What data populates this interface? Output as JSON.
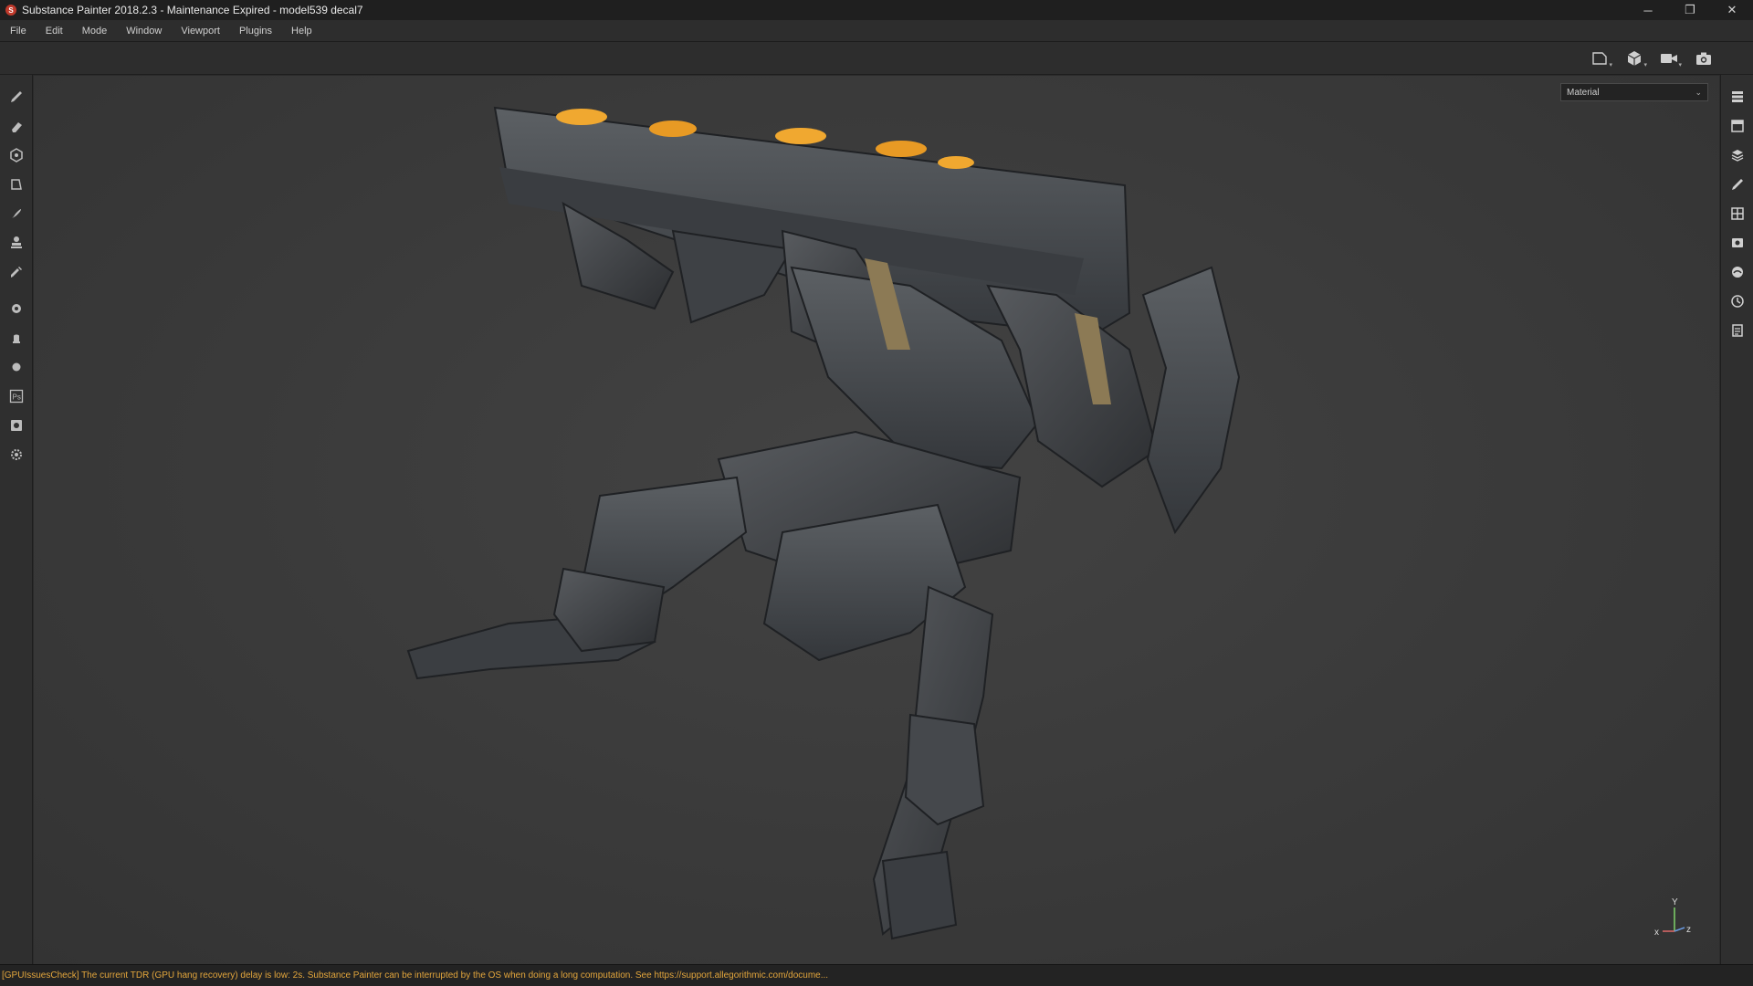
{
  "window": {
    "title": "Substance Painter 2018.2.3 - Maintenance Expired - model539 decal7",
    "controls": {
      "minimize": "─",
      "restore": "❐",
      "close": "✕"
    }
  },
  "menu": {
    "items": [
      "File",
      "Edit",
      "Mode",
      "Window",
      "Viewport",
      "Plugins",
      "Help"
    ]
  },
  "viewport_toolbar": {
    "icons": [
      "2d-view-icon",
      "3d-view-icon",
      "camera-icon",
      "screenshot-icon"
    ]
  },
  "left_tools": [
    "paint-brush-icon",
    "eraser-icon",
    "projection-icon",
    "polygon-fill-icon",
    "smudge-icon",
    "clone-icon",
    "color-picker-icon",
    "bake-icon",
    "iray-icon",
    "plugin-icon",
    "photoshop-icon",
    "export-icon",
    "settings-icon"
  ],
  "right_panels": [
    "layers-panel-icon",
    "texture-set-icon",
    "layer-stack-icon",
    "brush-settings-icon",
    "uv-grid-icon",
    "display-settings-icon",
    "environment-icon",
    "history-icon",
    "log-icon"
  ],
  "channel": {
    "selected": "Material"
  },
  "axis": {
    "y": "Y",
    "x": "x",
    "z": "z"
  },
  "status": {
    "message": "[GPUIssuesCheck] The current TDR (GPU hang recovery) delay is low: 2s. Substance Painter can be interrupted by the OS when doing a long computation. See https://support.allegorithmic.com/docume..."
  },
  "colors": {
    "accent_warning": "#e3a63c",
    "model_body": "#4b4e52",
    "model_highlight": "#f0a830"
  }
}
